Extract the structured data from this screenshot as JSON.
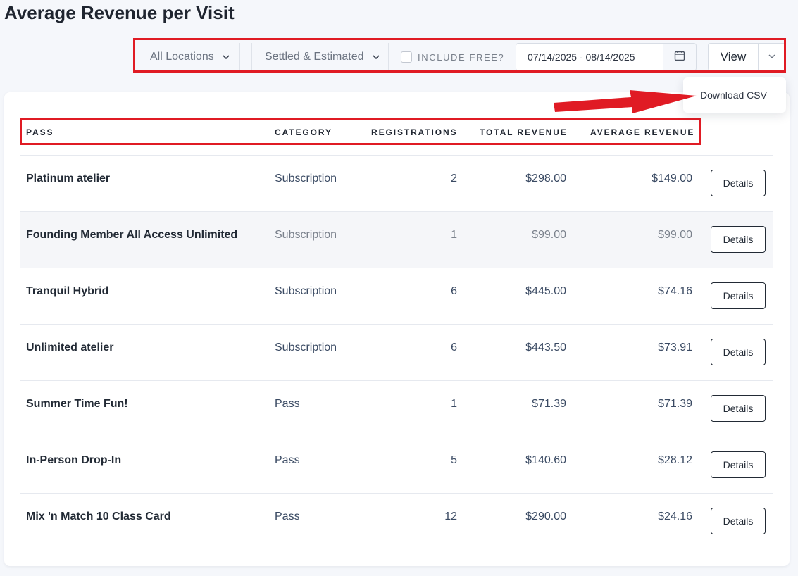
{
  "page": {
    "title": "Average Revenue per Visit"
  },
  "filters": {
    "location": "All Locations",
    "revenue_type": "Settled & Estimated",
    "include_free_label": "INCLUDE FREE?",
    "include_free_checked": false,
    "date_range": "07/14/2025 - 08/14/2025",
    "view_label": "View"
  },
  "menu": {
    "download_csv": "Download CSV"
  },
  "table": {
    "headers": {
      "pass": "PASS",
      "category": "CATEGORY",
      "registrations": "REGISTRATIONS",
      "total_revenue": "TOTAL REVENUE",
      "average_revenue": "AVERAGE REVENUE"
    },
    "rows": [
      {
        "pass": "Platinum atelier",
        "category": "Subscription",
        "registrations": "2",
        "total": "$298.00",
        "average": "$149.00",
        "action": "Details"
      },
      {
        "pass": "Founding Member All Access Unlimited",
        "category": "Subscription",
        "registrations": "1",
        "total": "$99.00",
        "average": "$99.00",
        "action": "Details"
      },
      {
        "pass": "Tranquil Hybrid",
        "category": "Subscription",
        "registrations": "6",
        "total": "$445.00",
        "average": "$74.16",
        "action": "Details"
      },
      {
        "pass": "Unlimited atelier",
        "category": "Subscription",
        "registrations": "6",
        "total": "$443.50",
        "average": "$73.91",
        "action": "Details"
      },
      {
        "pass": "Summer Time Fun!",
        "category": "Pass",
        "registrations": "1",
        "total": "$71.39",
        "average": "$71.39",
        "action": "Details"
      },
      {
        "pass": "In-Person Drop-In",
        "category": "Pass",
        "registrations": "5",
        "total": "$140.60",
        "average": "$28.12",
        "action": "Details"
      },
      {
        "pass": "Mix 'n Match 10 Class Card",
        "category": "Pass",
        "registrations": "12",
        "total": "$290.00",
        "average": "$24.16",
        "action": "Details"
      }
    ]
  },
  "icons": {
    "chevron": "chevron-down-icon",
    "calendar": "calendar-icon"
  },
  "colors": {
    "highlight": "#e01b24"
  }
}
